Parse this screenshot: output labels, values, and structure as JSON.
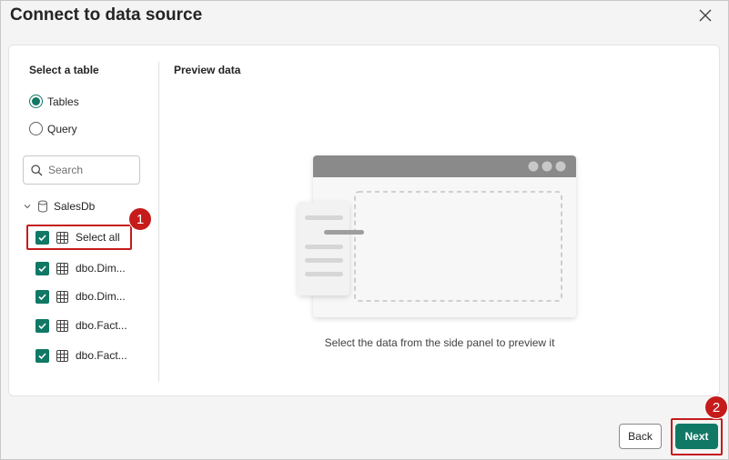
{
  "dialog": {
    "title": "Connect to data source"
  },
  "left_panel": {
    "title": "Select a table",
    "radio_options": [
      {
        "label": "Tables",
        "checked": true
      },
      {
        "label": "Query",
        "checked": false
      }
    ],
    "search": {
      "placeholder": "Search",
      "value": ""
    },
    "tree": {
      "root_label": "SalesDb",
      "items": [
        {
          "label": "Select all",
          "checked": true
        },
        {
          "label": "dbo.Dim...",
          "checked": true
        },
        {
          "label": "dbo.Dim...",
          "checked": true
        },
        {
          "label": "dbo.Fact...",
          "checked": true
        },
        {
          "label": "dbo.Fact...",
          "checked": true
        }
      ]
    }
  },
  "preview": {
    "title": "Preview data",
    "hint": "Select the data from the side panel to preview it"
  },
  "footer": {
    "back_label": "Back",
    "next_label": "Next"
  },
  "annotations": {
    "step1": "1",
    "step2": "2"
  },
  "colors": {
    "accent": "#117865",
    "annotation": "#c51b1b"
  }
}
